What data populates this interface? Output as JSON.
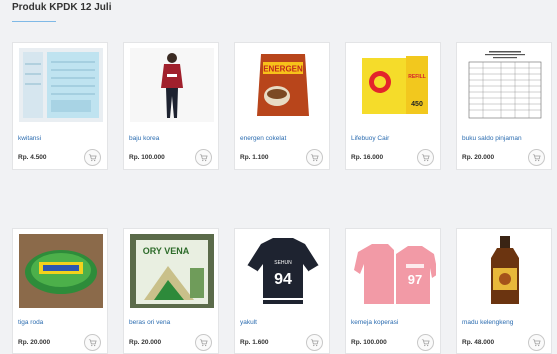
{
  "page": {
    "title": "Produk KPDK 12 Juli"
  },
  "products": [
    {
      "name": "kwitansi",
      "price": "Rp. 4.500"
    },
    {
      "name": "baju korea",
      "price": "Rp. 100.000"
    },
    {
      "name": "energen cokelat",
      "price": "Rp. 1.100"
    },
    {
      "name": "Lifebuoy Cair",
      "price": "Rp. 16.000"
    },
    {
      "name": "buku saldo pinjaman",
      "price": "Rp. 20.000"
    },
    {
      "name": "tiga roda",
      "price": "Rp. 20.000"
    },
    {
      "name": "beras ori vena",
      "price": "Rp. 20.000"
    },
    {
      "name": "yakult",
      "price": "Rp. 1.600"
    },
    {
      "name": "kemeja koperasi",
      "price": "Rp. 100.000"
    },
    {
      "name": "madu kelengkeng",
      "price": "Rp. 48.000"
    }
  ],
  "image_text": {
    "energen": "ENERGEN",
    "lifebuoy_refill": "REFILL",
    "lifebuoy_volume": "450",
    "jersey_number": "94",
    "sweater_number": "97",
    "sweater_lettering": "SEHUN",
    "rice_brand": "ORY VENA"
  },
  "colors": {
    "link": "#2b6cb0",
    "accent_line": "#7fb9e6"
  }
}
